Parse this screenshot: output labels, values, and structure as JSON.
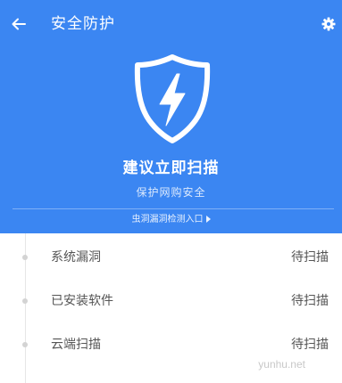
{
  "header": {
    "back_icon": "arrow-left-icon",
    "title": "安全防护",
    "settings_icon": "gear-icon",
    "background_color": "#3b86f2"
  },
  "hero": {
    "icon": "shield-lightning-icon",
    "headline": "建议立即扫描",
    "subline": "保护网购安全",
    "vuln_link": "虫洞漏洞检测入口"
  },
  "scan_items": [
    {
      "label": "系统漏洞",
      "status": "待扫描"
    },
    {
      "label": "已安装软件",
      "status": "待扫描"
    },
    {
      "label": "云端扫描",
      "status": "待扫描"
    }
  ],
  "watermark": "yunhu.net"
}
